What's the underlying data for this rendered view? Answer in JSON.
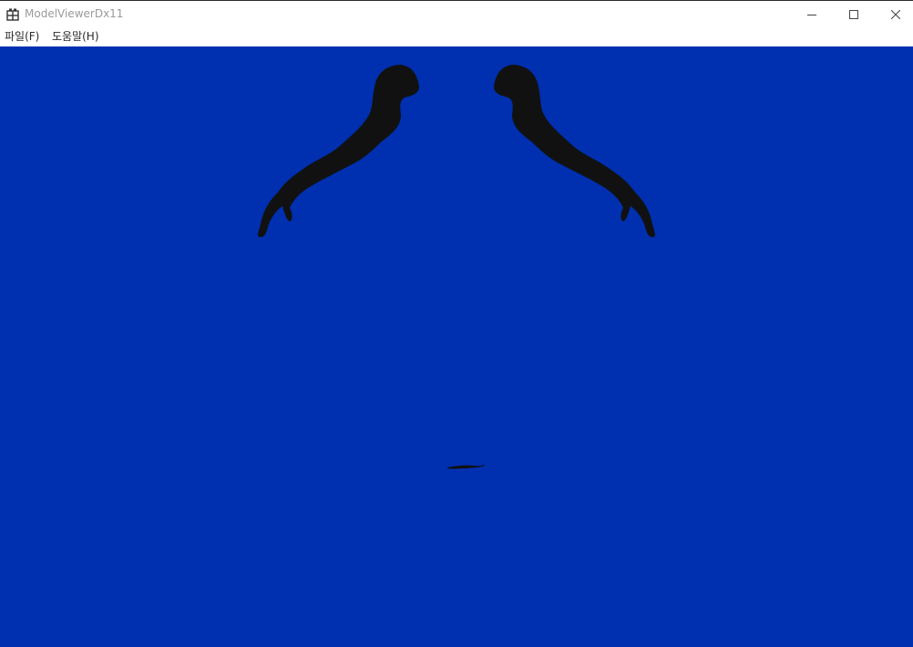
{
  "window": {
    "title": "ModelViewerDx11",
    "icon": "app-window-icon"
  },
  "caption_buttons": {
    "minimize_icon": "minimize-icon",
    "maximize_icon": "maximize-icon",
    "close_icon": "close-icon"
  },
  "menu": {
    "items": [
      {
        "label": "파일(F)"
      },
      {
        "label": "도움말(H)"
      }
    ]
  },
  "viewport": {
    "background_color": "#0030b0",
    "model_color": "#111111"
  }
}
